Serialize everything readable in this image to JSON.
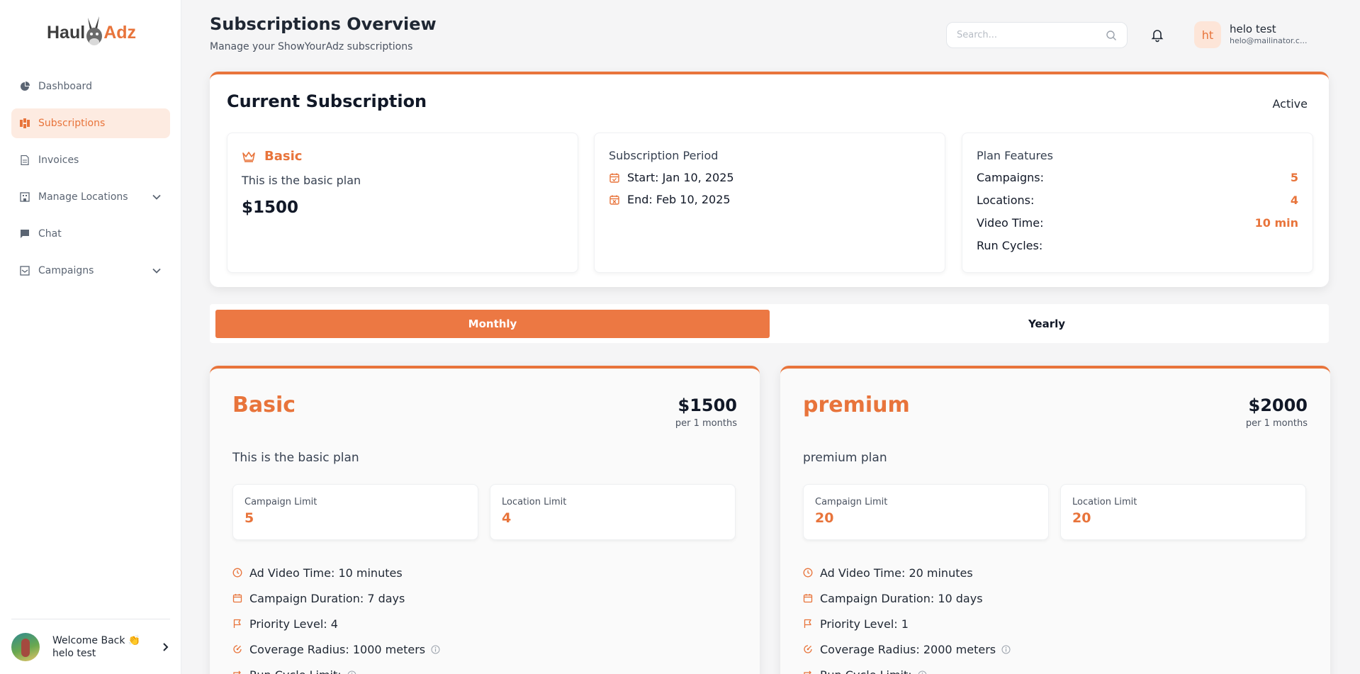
{
  "brand": {
    "logo_left": "Haul",
    "logo_right": "Adz",
    "accent": "#e8743b"
  },
  "sidebar": {
    "items": [
      {
        "label": "Dashboard",
        "icon": "pie-chart-icon"
      },
      {
        "label": "Subscriptions",
        "icon": "subscriptions-icon",
        "active": true
      },
      {
        "label": "Invoices",
        "icon": "document-icon"
      },
      {
        "label": "Manage Locations",
        "icon": "building-icon",
        "expandable": true
      },
      {
        "label": "Chat",
        "icon": "chat-icon"
      },
      {
        "label": "Campaigns",
        "icon": "campaign-icon",
        "expandable": true
      }
    ],
    "profile": {
      "welcome": "Welcome Back 👏",
      "name": "helo test"
    }
  },
  "header": {
    "title": "Subscriptions Overview",
    "subtitle": "Manage your ShowYourAdz subscriptions",
    "search_placeholder": "Search...",
    "user": {
      "initials": "ht",
      "name": "helo test",
      "email": "helo@mailinator.c..."
    }
  },
  "current": {
    "title": "Current Subscription",
    "status": "Active",
    "plan": {
      "name": "Basic",
      "description": "This is the basic plan",
      "price": "$1500"
    },
    "period": {
      "heading": "Subscription Period",
      "start": "Start: Jan 10, 2025",
      "end": "End: Feb 10, 2025"
    },
    "features": {
      "heading": "Plan Features",
      "rows": [
        {
          "label": "Campaigns:",
          "value": "5"
        },
        {
          "label": "Locations:",
          "value": "4"
        },
        {
          "label": "Video Time:",
          "value": "10 min"
        },
        {
          "label": "Run Cycles:",
          "value": ""
        }
      ]
    }
  },
  "billing_toggle": {
    "monthly": "Monthly",
    "yearly": "Yearly",
    "selected": "Monthly"
  },
  "plans": [
    {
      "name": "Basic",
      "price": "$1500",
      "per": "per 1 months",
      "description": "This is the basic plan",
      "campaign_limit_label": "Campaign Limit",
      "campaign_limit": "5",
      "location_limit_label": "Location Limit",
      "location_limit": "4",
      "features": [
        "Ad Video Time: 10 minutes",
        "Campaign Duration: 7 days",
        "Priority Level: 4",
        "Coverage Radius: 1000 meters",
        "Run Cycle Limit:"
      ]
    },
    {
      "name": "premium",
      "price": "$2000",
      "per": "per 1 months",
      "description": "premium plan",
      "campaign_limit_label": "Campaign Limit",
      "campaign_limit": "20",
      "location_limit_label": "Location Limit",
      "location_limit": "20",
      "features": [
        "Ad Video Time: 20 minutes",
        "Campaign Duration: 10 days",
        "Priority Level: 1",
        "Coverage Radius: 2000 meters",
        "Run Cycle Limit:"
      ]
    }
  ]
}
